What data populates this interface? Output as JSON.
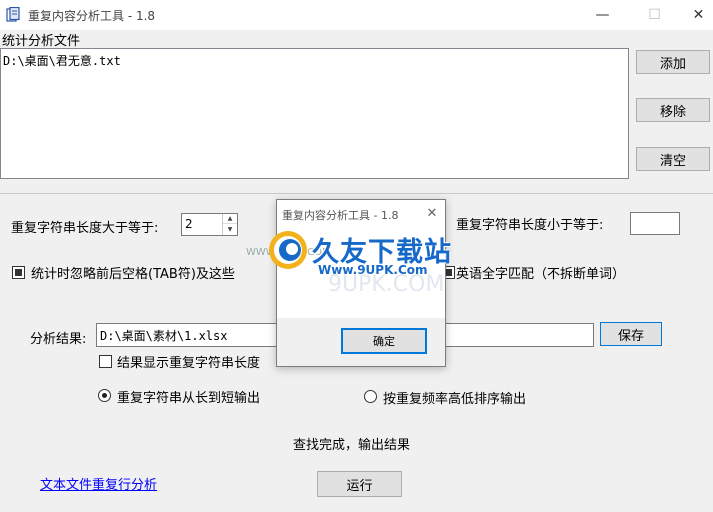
{
  "window": {
    "title": "重复内容分析工具 - 1.8",
    "controls": {
      "minimize": "—",
      "maximize": "☐",
      "close": "✕"
    }
  },
  "files": {
    "label": "统计分析文件",
    "items": [
      "D:\\桌面\\君无意.txt"
    ],
    "add_button": "添加",
    "remove_button": "移除",
    "clear_button": "清空"
  },
  "options": {
    "min_length_label": "重复字符串长度大于等于:",
    "min_length_value": "2",
    "max_length_label": "重复字符串长度小于等于:",
    "max_length_value": "",
    "ignore_whitespace_label": "统计时忽略前后空格(TAB符)及这些",
    "ignore_whitespace_checked": true,
    "english_whole_word_label": "英语全字匹配（不拆断单词）",
    "english_whole_word_checked": true
  },
  "output": {
    "result_label": "分析结果:",
    "result_path": "D:\\桌面\\素材\\1.xlsx",
    "save_button": "保存",
    "show_length_label": "结果显示重复字符串长度",
    "show_length_checked": false,
    "order_long_to_short_label": "重复字符串从长到短输出",
    "order_long_to_short_selected": true,
    "order_by_frequency_label": "按重复频率高低排序输出",
    "order_by_frequency_selected": false
  },
  "status": {
    "message": "查找完成，输出结果"
  },
  "footer": {
    "line_analysis_link": "文本文件重复行分析",
    "run_button": "运行"
  },
  "dialog": {
    "title": "重复内容分析工具 - 1.8",
    "close": "✕",
    "ok_button": "确定"
  },
  "watermark": {
    "brand": "久友下载站",
    "url": "Www.9UPK.Com",
    "small": "WWW.9UPK.COM",
    "shadow": "9UPK.COM"
  },
  "colors": {
    "window_bg": "#f0f0f0",
    "accent": "#0078d7",
    "link": "#0000ff",
    "watermark": "#1669c8"
  }
}
